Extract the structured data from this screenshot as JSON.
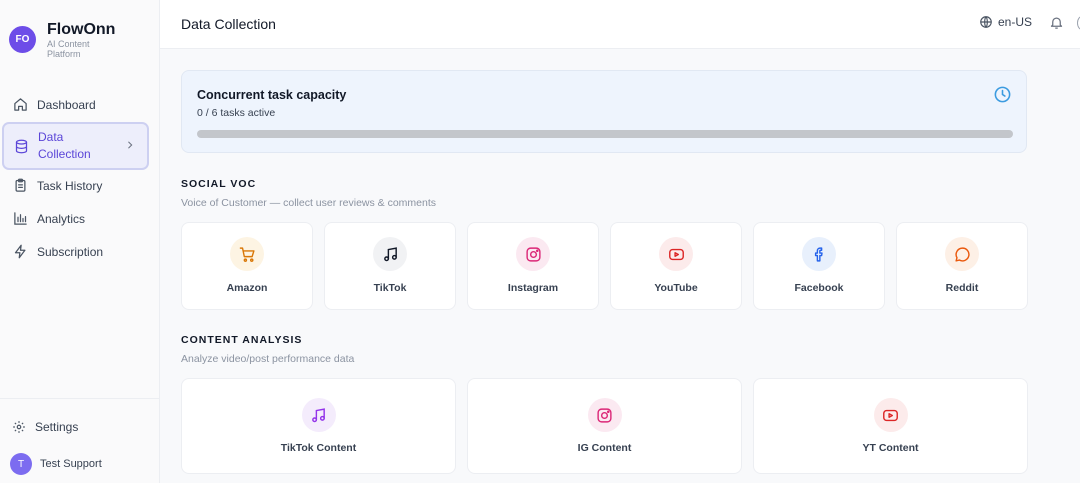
{
  "app": {
    "avatar_initials": "FO",
    "name": "FlowOnn",
    "subtitle": "AI Content Platform"
  },
  "sidebar": {
    "items": [
      {
        "label": "Dashboard",
        "icon": "home-icon"
      },
      {
        "label": "Data Collection",
        "icon": "database-icon",
        "active": true
      },
      {
        "label": "Task History",
        "icon": "clipboard-icon"
      },
      {
        "label": "Analytics",
        "icon": "bar-chart-icon"
      },
      {
        "label": "Subscription",
        "icon": "lightning-icon"
      }
    ],
    "settings_label": "Settings",
    "user_initial": "T",
    "user_name": "Test Support"
  },
  "header": {
    "title": "Data Collection",
    "language": "en-US"
  },
  "capacity": {
    "title": "Concurrent task capacity",
    "status": "0 / 6 tasks active",
    "progress_fraction": 0
  },
  "social_voc": {
    "title": "SOCIAL VOC",
    "subtitle": "Voice of Customer — collect user reviews & comments",
    "cards": [
      {
        "label": "Amazon",
        "icon": "cart-icon",
        "color": "#d97706",
        "bg": "#fdf4e3"
      },
      {
        "label": "TikTok",
        "icon": "music-note-icon",
        "color": "#111827",
        "bg": "#f1f2f4"
      },
      {
        "label": "Instagram",
        "icon": "instagram-icon",
        "color": "#db2777",
        "bg": "#fbe9f1"
      },
      {
        "label": "YouTube",
        "icon": "youtube-icon",
        "color": "#dc2626",
        "bg": "#fcebeb"
      },
      {
        "label": "Facebook",
        "icon": "facebook-icon",
        "color": "#2563eb",
        "bg": "#e8f0fc"
      },
      {
        "label": "Reddit",
        "icon": "chat-bubble-icon",
        "color": "#ea580c",
        "bg": "#fdf0e6"
      }
    ]
  },
  "content_analysis": {
    "title": "CONTENT ANALYSIS",
    "subtitle": "Analyze video/post performance data",
    "cards": [
      {
        "label": "TikTok Content",
        "icon": "music-note-icon",
        "color": "#9333ea",
        "bg": "#f4ecfc"
      },
      {
        "label": "IG Content",
        "icon": "instagram-icon",
        "color": "#db2777",
        "bg": "#fbe9f1"
      },
      {
        "label": "YT Content",
        "icon": "youtube-icon",
        "color": "#dc2626",
        "bg": "#fcebeb"
      }
    ]
  }
}
